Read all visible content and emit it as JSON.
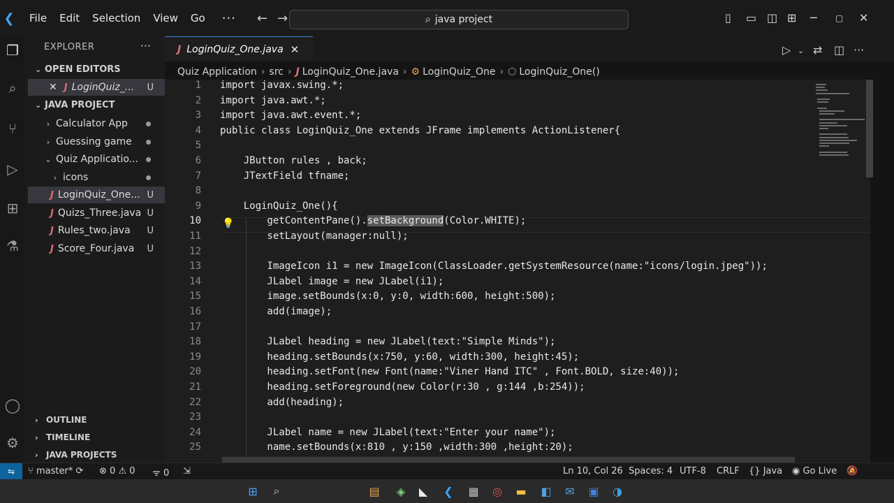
{
  "menu": [
    "File",
    "Edit",
    "Selection",
    "View",
    "Go"
  ],
  "search": {
    "text": "java project"
  },
  "explorer": {
    "title": "EXPLORER",
    "open_editors_label": "OPEN EDITORS",
    "open_editor_file": "LoginQuiz_...",
    "open_editor_status": "U",
    "project_label": "JAVA PROJECT",
    "tree": [
      {
        "label": "Calculator App",
        "type": "folder"
      },
      {
        "label": "Guessing game",
        "type": "folder"
      },
      {
        "label": "Quiz Applicatio...",
        "type": "folder-open"
      },
      {
        "label": "icons",
        "type": "folder"
      },
      {
        "label": "LoginQuiz_One...",
        "type": "file",
        "status": "U"
      },
      {
        "label": "Quizs_Three.java",
        "type": "file",
        "status": "U"
      },
      {
        "label": "Rules_two.java",
        "type": "file",
        "status": "U"
      },
      {
        "label": "Score_Four.java",
        "type": "file",
        "status": "U"
      }
    ],
    "outline_label": "OUTLINE",
    "timeline_label": "TIMELINE",
    "java_projects_label": "JAVA PROJECTS"
  },
  "tab": {
    "label": "LoginQuiz_One.java"
  },
  "breadcrumb": {
    "folder": "Quiz Application",
    "src": "src",
    "file": "LoginQuiz_One.java",
    "class": "LoginQuiz_One",
    "method": "LoginQuiz_One()"
  },
  "code_lines": [
    {
      "n": "1",
      "pre": "import javax.swing.*;",
      "hl": "",
      "post": ""
    },
    {
      "n": "2",
      "pre": "import java.awt.*;",
      "hl": "",
      "post": ""
    },
    {
      "n": "3",
      "pre": "import java.awt.event.*;",
      "hl": "",
      "post": ""
    },
    {
      "n": "4",
      "pre": "public class LoginQuiz_One extends JFrame implements ActionListener{",
      "hl": "",
      "post": ""
    },
    {
      "n": "5",
      "pre": "",
      "hl": "",
      "post": ""
    },
    {
      "n": "6",
      "pre": "    JButton rules , back;",
      "hl": "",
      "post": ""
    },
    {
      "n": "7",
      "pre": "    JTextField tfname;",
      "hl": "",
      "post": ""
    },
    {
      "n": "8",
      "pre": "",
      "hl": "",
      "post": ""
    },
    {
      "n": "9",
      "pre": "    LoginQuiz_One(){",
      "hl": "",
      "post": ""
    },
    {
      "n": "10",
      "pre": "        getContentPane().",
      "hl": "setBackground",
      "post": "(Color.WHITE);"
    },
    {
      "n": "11",
      "pre": "        setLayout(manager:null);",
      "hl": "",
      "post": ""
    },
    {
      "n": "12",
      "pre": "",
      "hl": "",
      "post": ""
    },
    {
      "n": "13",
      "pre": "        ImageIcon i1 = new ImageIcon(ClassLoader.getSystemResource(name:\"icons/login.jpeg\"));",
      "hl": "",
      "post": ""
    },
    {
      "n": "14",
      "pre": "        JLabel image = new JLabel(i1);",
      "hl": "",
      "post": ""
    },
    {
      "n": "15",
      "pre": "        image.setBounds(x:0, y:0, width:600, height:500);",
      "hl": "",
      "post": ""
    },
    {
      "n": "16",
      "pre": "        add(image);",
      "hl": "",
      "post": ""
    },
    {
      "n": "17",
      "pre": "",
      "hl": "",
      "post": ""
    },
    {
      "n": "18",
      "pre": "        JLabel heading = new JLabel(text:\"Simple Minds\");",
      "hl": "",
      "post": ""
    },
    {
      "n": "19",
      "pre": "        heading.setBounds(x:750, y:60, width:300, height:45);",
      "hl": "",
      "post": ""
    },
    {
      "n": "20",
      "pre": "        heading.setFont(new Font(name:\"Viner Hand ITC\" , Font.BOLD, size:40));",
      "hl": "",
      "post": ""
    },
    {
      "n": "21",
      "pre": "        heading.setForeground(new Color(r:30 , g:144 ,b:254));",
      "hl": "",
      "post": ""
    },
    {
      "n": "22",
      "pre": "        add(heading);",
      "hl": "",
      "post": ""
    },
    {
      "n": "23",
      "pre": "",
      "hl": "",
      "post": ""
    },
    {
      "n": "24",
      "pre": "        JLabel name = new JLabel(text:\"Enter your name\");",
      "hl": "",
      "post": ""
    },
    {
      "n": "25",
      "pre": "        name.setBounds(x:810 , y:150 ,width:300 ,height:20);",
      "hl": "",
      "post": ""
    }
  ],
  "current_line": "10",
  "status": {
    "branch": "master*",
    "errors": "0",
    "warnings": "0",
    "info": "0",
    "position": "Ln 10, Col 26",
    "spaces": "Spaces: 4",
    "encoding": "UTF-8",
    "eol": "CRLF",
    "language": "Java",
    "golive": "Go Live"
  },
  "colors": {
    "accent": "#3f7fd6",
    "java_icon": "#e06c75",
    "remote": "#0e639c"
  }
}
